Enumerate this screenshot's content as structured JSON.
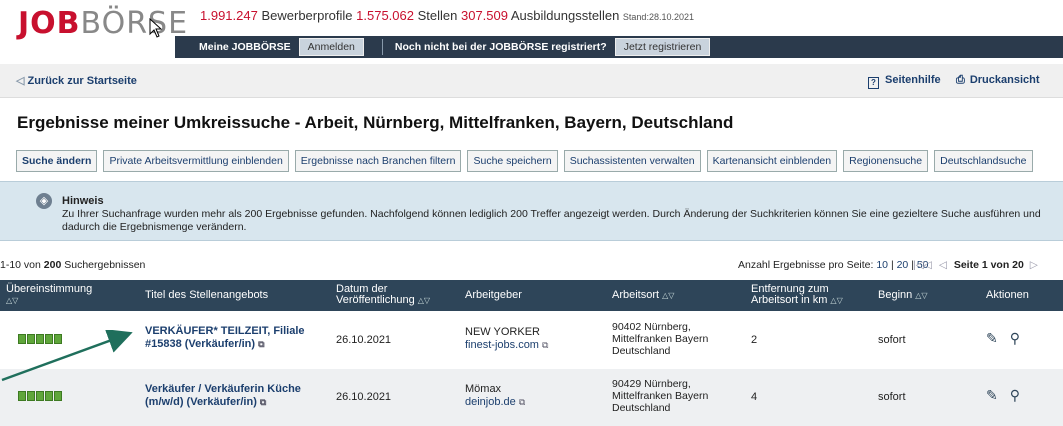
{
  "header": {
    "logo_job": "JOB",
    "logo_boerse": "BÖRSE",
    "stats": {
      "profiles_count": "1.991.247",
      "profiles_label": "Bewerberprofile",
      "jobs_count": "1.575.062",
      "jobs_label": "Stellen",
      "apprentice_count": "307.509",
      "apprentice_label": "Ausbildungsstellen",
      "stand": "Stand:28.10.2021"
    },
    "topbar": {
      "my_label": "Meine JOBBÖRSE",
      "login": "Anmelden",
      "not_registered": "Noch nicht bei der JOBBÖRSE registriert?",
      "register": "Jetzt registrieren"
    }
  },
  "nav": {
    "back": "Zurück zur Startseite",
    "help": "Seitenhilfe",
    "print": "Druckansicht"
  },
  "page_title": "Ergebnisse meiner Umkreissuche - Arbeit, Nürnberg, Mittelfranken, Bayern, Deutschland",
  "buttons": [
    "Suche ändern",
    "Private Arbeitsvermittlung einblenden",
    "Ergebnisse nach Branchen filtern",
    "Suche speichern",
    "Suchassistenten verwalten",
    "Kartenansicht einblenden",
    "Regionensuche",
    "Deutschlandsuche"
  ],
  "hinweis": {
    "title": "Hinweis",
    "text": "Zu Ihrer Suchanfrage wurden mehr als 200 Ergebnisse gefunden. Nachfolgend können lediglich 200 Treffer angezeigt werden. Durch Änderung der Suchkriterien können Sie eine gezieltere Suche ausführen und dadurch die Ergebnismenge verändern."
  },
  "results": {
    "range": "1-10 von",
    "total": "200",
    "suffix": "Suchergebnissen",
    "per_page_label": "Anzahl Ergebnisse pro Seite:",
    "per_page_10": "10",
    "per_page_20": "20",
    "per_page_50": "50",
    "page_info": "Seite 1 von 20"
  },
  "table": {
    "headers": {
      "match": "Übereinstimmung",
      "title": "Titel des Stellenangebots",
      "date_1": "Datum der",
      "date_2": "Veröffentlichung",
      "employer": "Arbeitgeber",
      "location": "Arbeitsort",
      "distance_1": "Entfernung zum",
      "distance_2": "Arbeitsort in km",
      "start": "Beginn",
      "actions": "Aktionen"
    },
    "rows": [
      {
        "title_1": "VERKÄUFER* TEILZEIT, Filiale",
        "title_2": "#15838 (Verkäufer/in)",
        "date": "26.10.2021",
        "employer": "NEW YORKER",
        "employer_link": "finest-jobs.com",
        "loc_1": "90402 Nürnberg,",
        "loc_2": "Mittelfranken Bayern",
        "loc_3": "Deutschland",
        "distance": "2",
        "start": "sofort"
      },
      {
        "title_1": "Verkäufer / Verkäuferin Küche",
        "title_2": "(m/w/d) (Verkäufer/in)",
        "date": "26.10.2021",
        "employer": "Mömax",
        "employer_link": "deinjob.de",
        "loc_1": "90429 Nürnberg,",
        "loc_2": "Mittelfranken Bayern",
        "loc_3": "Deutschland",
        "distance": "4",
        "start": "sofort"
      }
    ]
  },
  "icons": {
    "match_bars": "match-score-bars",
    "pin": "pin-icon",
    "location": "map-marker-icon",
    "external": "external-link-icon"
  },
  "colors": {
    "brand_red": "#c8102e",
    "header_dark": "#2b3a4c",
    "table_head": "#2e4559",
    "match_green": "#5fa63a",
    "hinweis_bg": "#d8e6ee"
  }
}
